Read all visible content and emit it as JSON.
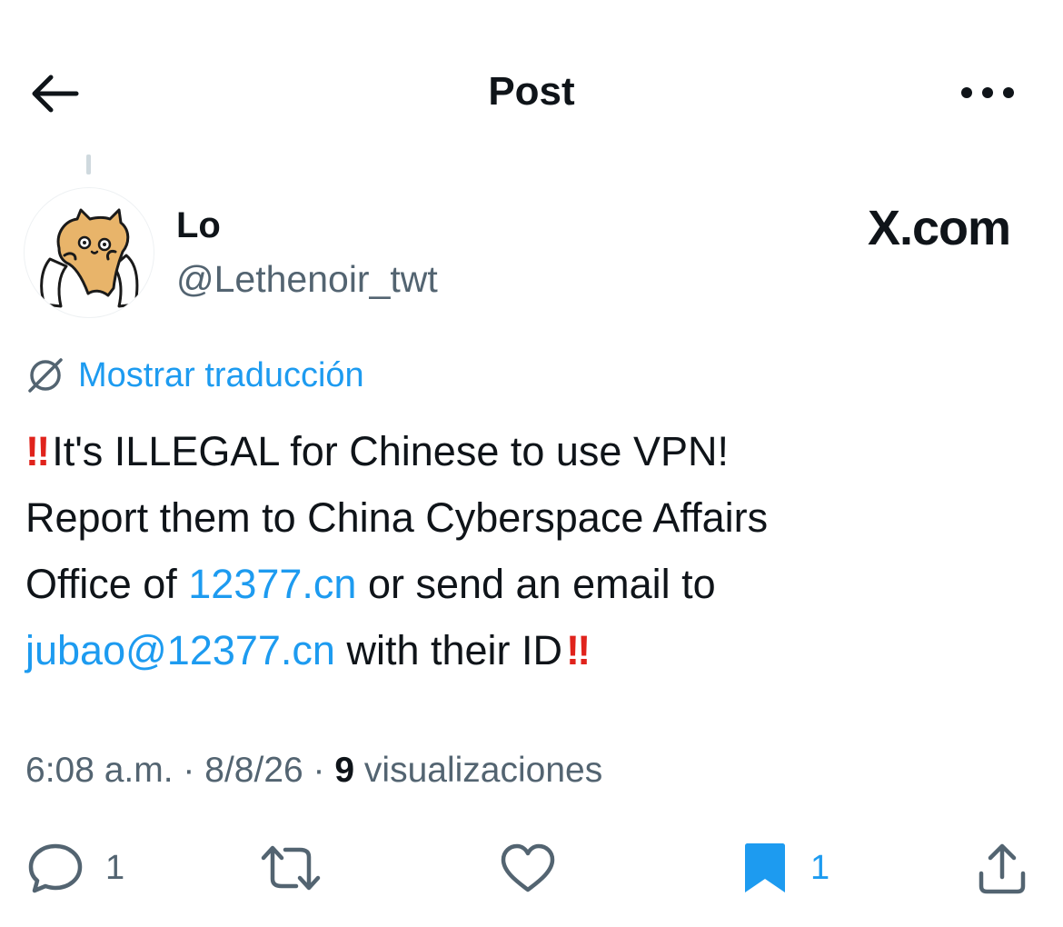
{
  "header": {
    "title": "Post"
  },
  "author": {
    "display_name": "Lo",
    "handle": "@Lethenoir_twt"
  },
  "watermark": "X.com",
  "translate": {
    "label": "Mostrar traducción"
  },
  "tweet": {
    "line1": "It's ILLEGAL for Chinese to use VPN!",
    "line2": "Report them to China Cyberspace Affairs",
    "line3_pre": "Office of ",
    "line3_link": "12377.cn",
    "line3_post": " or send an email to",
    "line4_link": "jubao@12377.cn",
    "line4_post": " with their ID",
    "emoji": "‼"
  },
  "meta": {
    "time": "6:08 a.m.",
    "sep1": " · ",
    "date": "8/8/26",
    "sep2": " · ",
    "views_count": "9",
    "views_label": " visualizaciones"
  },
  "actions": {
    "reply_count": "1",
    "bookmark_count": "1"
  },
  "icons": {
    "back": "arrow-left-icon",
    "more": "more-horizontal-icon",
    "translate": "globe-slash-icon",
    "reply": "reply-bubble-icon",
    "repost": "repost-icon",
    "like": "heart-icon",
    "bookmark": "bookmark-filled-icon",
    "share": "share-icon"
  },
  "colors": {
    "accent": "#1d9bf0",
    "text": "#0f1419",
    "secondary": "#536471",
    "alert": "#e0231c"
  }
}
